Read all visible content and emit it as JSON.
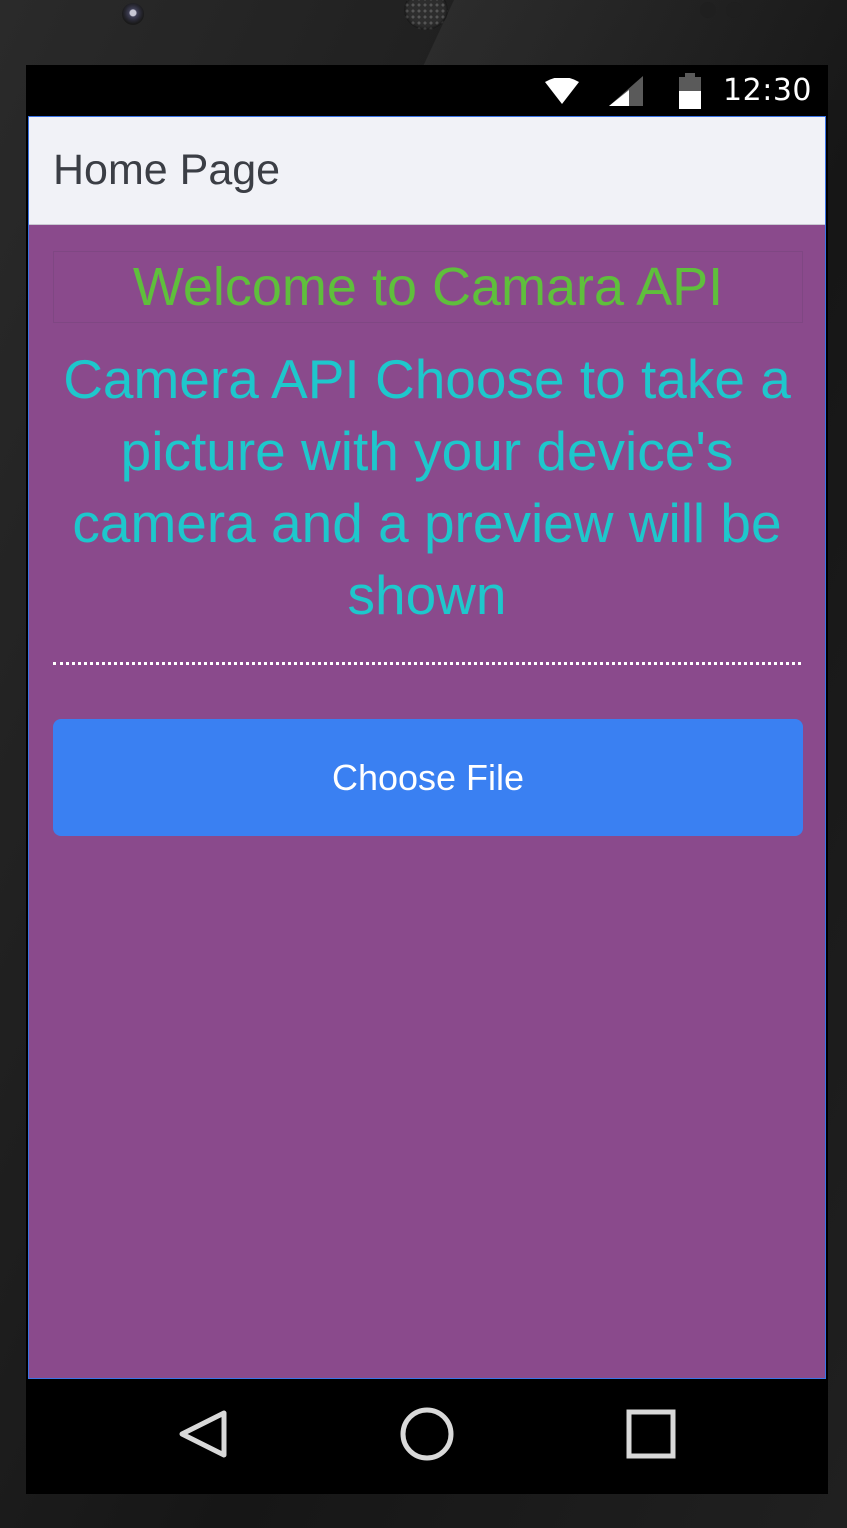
{
  "status_bar": {
    "time": "12:30",
    "icons": [
      "wifi-icon",
      "signal-icon",
      "battery-icon"
    ]
  },
  "header": {
    "title": "Home Page"
  },
  "main": {
    "welcome_text": "Welcome to Camara API",
    "description": "Camera API Choose to take a picture with your device's camera and a preview will be shown",
    "choose_file_label": "Choose File"
  },
  "nav_bar": {
    "buttons": [
      "back-icon",
      "home-icon",
      "recents-icon"
    ]
  },
  "colors": {
    "page_background": "#8a4a8c",
    "header_background": "#f1f2f7",
    "welcome_text": "#5fbf3c",
    "description_text": "#1ec7cc",
    "button_background": "#3a80f2",
    "button_text": "#ffffff"
  }
}
